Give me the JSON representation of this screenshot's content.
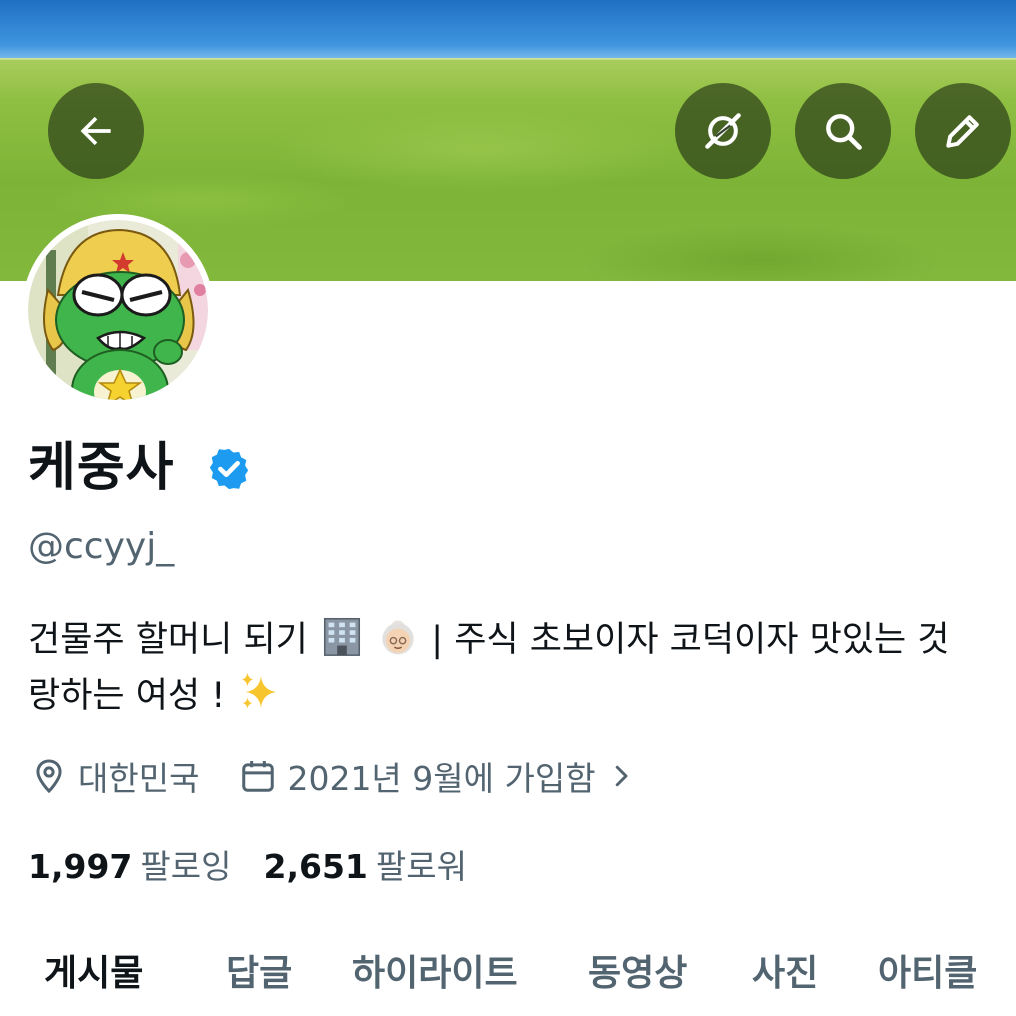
{
  "header": {
    "back_icon": "arrow-left-icon",
    "grok_icon": "grok-icon",
    "search_icon": "search-icon",
    "edit_icon": "pencil-icon"
  },
  "profile": {
    "display_name": "케중사",
    "handle": "@ccyyj_",
    "verified": true,
    "bio_line1_a": "건물주 할머니 되기",
    "bio_line1_b": "| 주식 초보이자 코덕이자 맛있는 것",
    "bio_line2": "랑하는 여성 !",
    "location": "대한민국",
    "joined": "2021년 9월에 가입함",
    "following_count": "1,997",
    "following_label": "팔로잉",
    "followers_count": "2,651",
    "followers_label": "팔로워"
  },
  "tabs": [
    {
      "label": "게시물",
      "active": true
    },
    {
      "label": "답글",
      "active": false
    },
    {
      "label": "하이라이트",
      "active": false
    },
    {
      "label": "동영상",
      "active": false
    },
    {
      "label": "사진",
      "active": false
    },
    {
      "label": "아티클",
      "active": false
    }
  ],
  "colors": {
    "verified_blue": "#1d9bf0",
    "text_primary": "#0f1419",
    "text_secondary": "#536471"
  }
}
